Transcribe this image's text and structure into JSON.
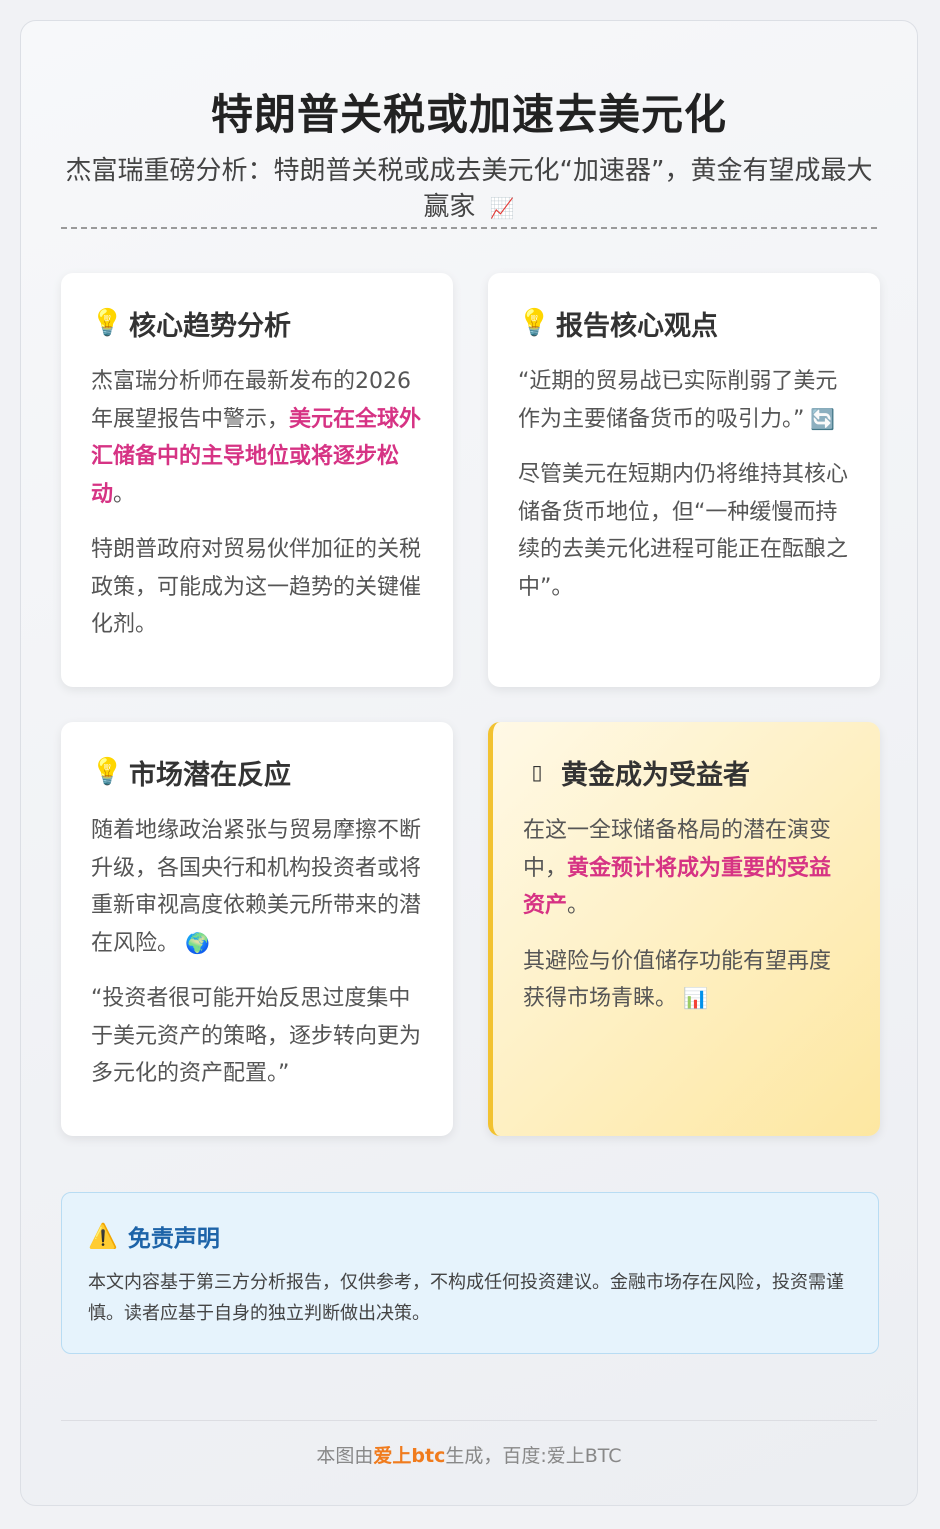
{
  "header": {
    "title": "特朗普关税或加速去美元化",
    "subtitle": "杰富瑞重磅分析：特朗普关税或成去美元化“加速器”，黄金有望成最大赢家",
    "subtitle_emoji": "📈"
  },
  "cards": [
    {
      "icon": "lightbulb-icon",
      "title": "核心趋势分析",
      "p1_before": "杰富瑞分析师在最新发布的2026年展望报告中警示，",
      "p1_highlight": "美元在全球外汇储备中的主导地位或将逐步松动",
      "p1_after": "。",
      "p2": "特朗普政府对贸易伙伴加征的关税政策，可能成为这一趋势的关键催化剂。"
    },
    {
      "icon": "lightbulb-icon",
      "title": "报告核心观点",
      "p1": "“近期的贸易战已实际削弱了美元作为主要储备货币的吸引力。”",
      "p1_emoji": "🔄",
      "p2": "尽管美元在短期内仍将维持其核心储备货币地位，但“一种缓慢而持续的去美元化进程可能正在酝酿之中”。"
    },
    {
      "icon": "lightbulb-icon",
      "title": "市场潜在反应",
      "p1": "随着地缘政治紧张与贸易摩擦不断升级，各国央行和机构投资者或将重新审视高度依赖美元所带来的潜在风险。",
      "p1_emoji": "🌍",
      "p2": "“投资者很可能开始反思过度集中于美元资产的策略，逐步转向更为多元化的资产配置。”"
    },
    {
      "icon": "gold-icon",
      "title": "黄金成为受益者",
      "p1_before": "在这一全球储备格局的潜在演变中，",
      "p1_highlight": "黄金预计将成为重要的受益资产",
      "p1_after": "。",
      "p2": "其避险与价值储存功能有望再度获得市场青睐。",
      "p2_emoji": "📊"
    }
  ],
  "disclaimer": {
    "icon": "warning-icon",
    "title": "免责声明",
    "text": "本文内容基于第三方分析报告，仅供参考，不构成任何投资建议。金融市场存在风险，投资需谨慎。读者应基于自身的独立判断做出决策。"
  },
  "footer": {
    "prefix": "本图由",
    "brand": "爱上btc",
    "suffix": "生成，百度:爱上BTC"
  },
  "colors": {
    "highlight": "#d63384",
    "disclaimer_title": "#1d63a8",
    "brand": "#f07b1d",
    "gold_border": "#f2c230"
  }
}
